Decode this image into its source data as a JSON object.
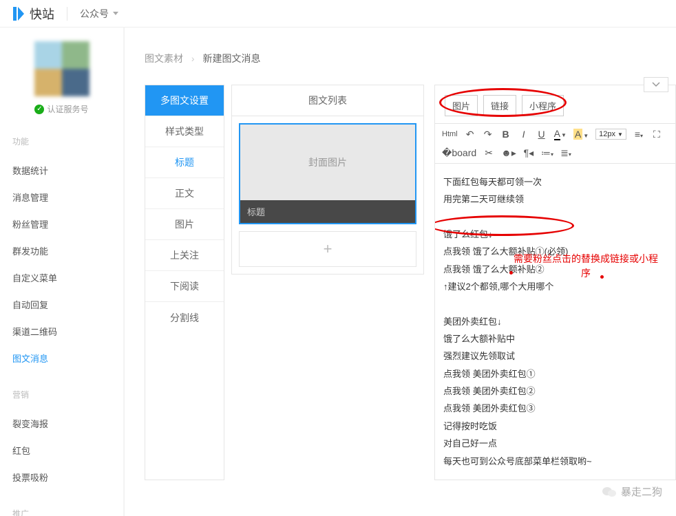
{
  "brand": "快站",
  "topNav": {
    "item": "公众号"
  },
  "profile": {
    "verifyLabel": "认证服务号"
  },
  "sidebar": {
    "sections": [
      {
        "title": "功能",
        "items": [
          "数据统计",
          "消息管理",
          "粉丝管理",
          "群发功能",
          "自定义菜单",
          "自动回复",
          "渠道二维码",
          "图文消息"
        ],
        "activeIndex": 7
      },
      {
        "title": "营销",
        "items": [
          "裂变海报",
          "红包",
          "投票吸粉"
        ],
        "activeIndex": -1
      },
      {
        "title": "推广",
        "items": [],
        "activeIndex": -1
      }
    ]
  },
  "breadcrumb": {
    "parent": "图文素材",
    "current": "新建图文消息"
  },
  "panel": {
    "header": "多图文设置",
    "tabs": [
      "样式类型",
      "标题",
      "正文",
      "图片",
      "上关注",
      "下阅读",
      "分割线"
    ],
    "selectedIndex": 1
  },
  "preview": {
    "listTitle": "图文列表",
    "coverText": "封面图片",
    "titleText": "标题",
    "addIcon": "+"
  },
  "editor": {
    "insertTabs": [
      "图片",
      "链接",
      "小程序"
    ],
    "toolbar": {
      "html": "Html",
      "fontSize": "12px"
    },
    "lines": [
      "下面红包每天都可领一次",
      "用完第二天可继续领",
      "",
      "饿了么红包↓",
      "点我领  饿了么大额补贴①(必领)",
      "点我领  饿了么大额补贴②",
      "↑建议2个都领,哪个大用哪个",
      "",
      "美团外卖红包↓",
      "饿了么大额补贴中",
      "强烈建议先领取试",
      "点我领  美团外卖红包①",
      "点我领  美团外卖红包②",
      "点我领  美团外卖红包③",
      "记得按时吃饭",
      "对自己好一点",
      "每天也可到公众号底部菜单栏领取哟~"
    ]
  },
  "annotation": "需要粉丝点击的替换成链接或小程序",
  "watermark": "暴走二狗"
}
